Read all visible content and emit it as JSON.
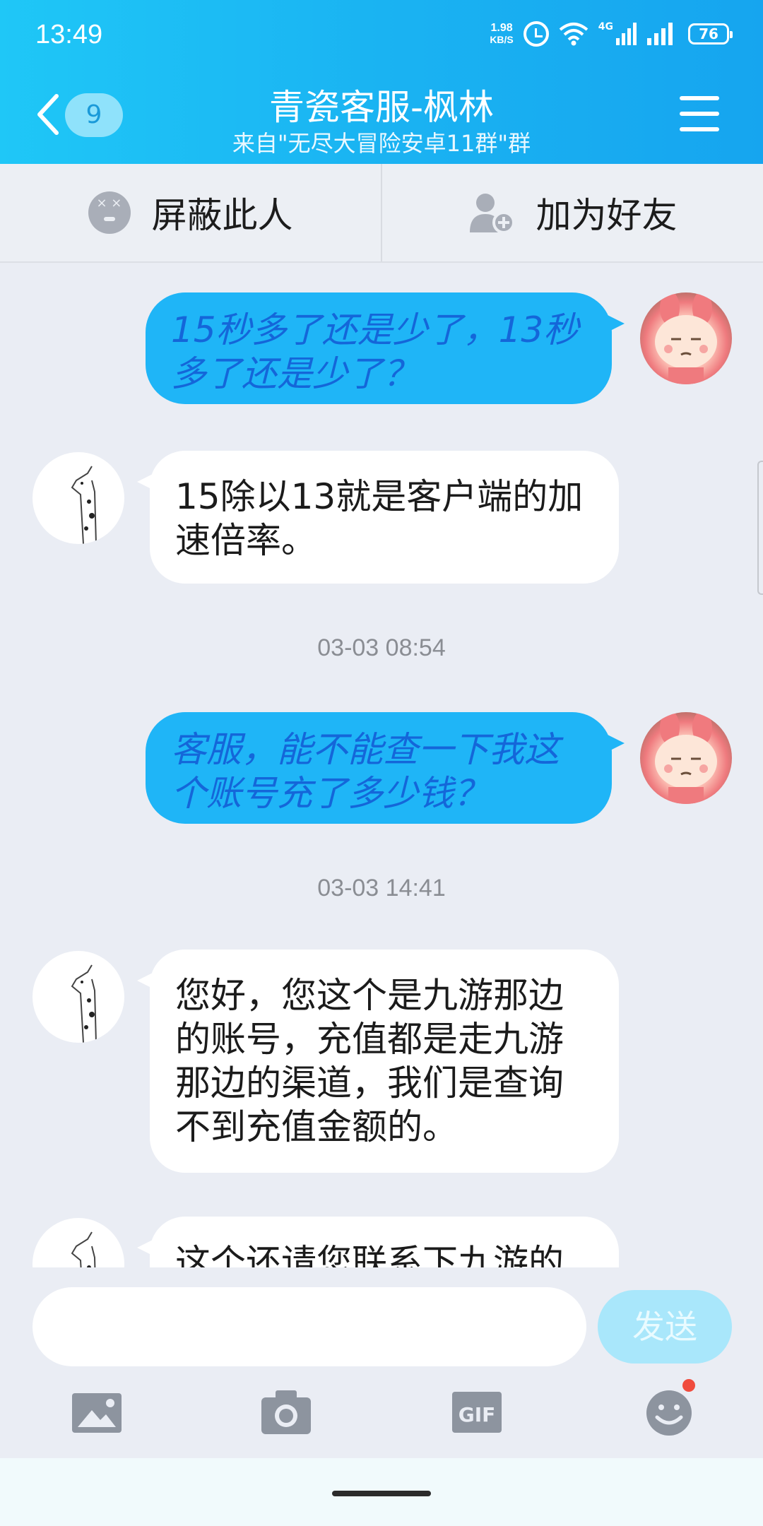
{
  "status_bar": {
    "time": "13:49",
    "speed_value": "1.98",
    "speed_unit": "KB/S",
    "network": "4G",
    "battery": "76"
  },
  "header": {
    "back_count": "9",
    "title": "青瓷客服-枫林",
    "subtitle": "来自\"无尽大冒险安卓11群\"群"
  },
  "actions": {
    "block": "屏蔽此人",
    "add_friend": "加为好友"
  },
  "messages": [
    {
      "from": "me",
      "text": "15秒多了还是少了，13秒多了还是少了？"
    },
    {
      "from": "them",
      "text": "15除以13就是客户端的加速倍率。"
    },
    {
      "timestamp": "03-03 08:54"
    },
    {
      "from": "me",
      "text": "客服，能不能查一下我这个账号充了多少钱？"
    },
    {
      "timestamp": "03-03 14:41"
    },
    {
      "from": "them",
      "text": "您好，您这个是九游那边的账号，充值都是走九游那边的渠道，我们是查询不到充值金额的。"
    },
    {
      "from": "them",
      "text": "这个还请您联系下九游的"
    }
  ],
  "input": {
    "placeholder": "",
    "send_label": "发送"
  },
  "toolbar": {
    "gif_label": "GIF"
  },
  "colors": {
    "header_start": "#1fc7f7",
    "header_end": "#16a5ef",
    "outgoing_bubble": "#1fb5f7",
    "outgoing_text": "#1466d9",
    "incoming_bubble": "#ffffff",
    "chat_background": "#eaedf4",
    "send_button": "#a9e7fb"
  }
}
